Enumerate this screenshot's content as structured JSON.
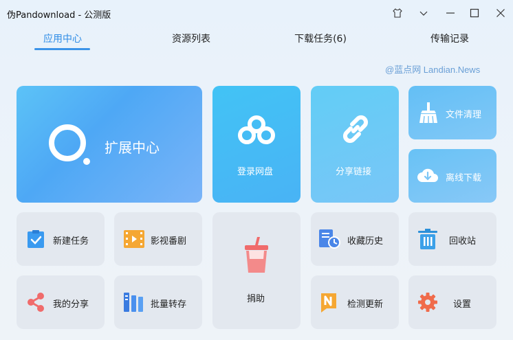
{
  "window": {
    "title": "伪Pandownload - 公测版"
  },
  "tabs": [
    {
      "label": "应用中心",
      "active": true
    },
    {
      "label": "资源列表",
      "active": false
    },
    {
      "label": "下载任务(6)",
      "active": false
    },
    {
      "label": "传输记录",
      "active": false
    }
  ],
  "watermark": "@蓝点网 Landian.News",
  "cards": {
    "extensions": "扩展中心",
    "login_disk": "登录网盘",
    "share_link": "分享链接",
    "file_clean": "文件清理",
    "offline_download": "离线下载",
    "new_task": "新建任务",
    "video": "影视番剧",
    "donate": "捐助",
    "favorites": "收藏历史",
    "recycle": "回收站",
    "my_share": "我的分享",
    "batch_save": "批量转存",
    "check_update": "检测更新",
    "settings": "设置"
  },
  "colors": {
    "accent": "#2e8ce6",
    "tile_light": "#e3e8ef",
    "tile_blue": "#4ea8f5"
  }
}
